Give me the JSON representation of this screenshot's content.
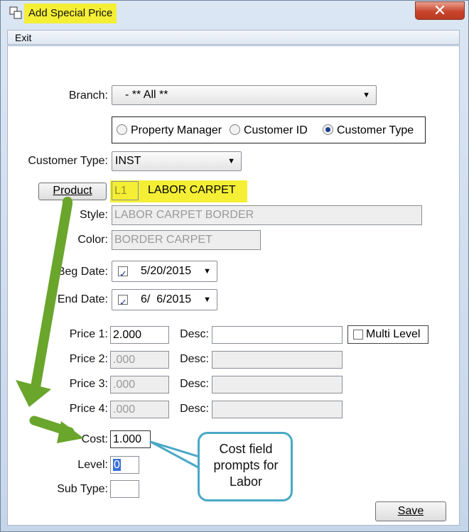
{
  "window": {
    "title": "Add Special Price",
    "close_glyph": "✕"
  },
  "menu": {
    "exit": "Exit"
  },
  "form": {
    "branch_label": "Branch:",
    "branch_value": "- ** All **",
    "radios": {
      "property_manager": "Property Manager",
      "customer_id": "Customer ID",
      "customer_type": "Customer Type",
      "selected": "customer_type"
    },
    "customer_type_label": "Customer Type:",
    "customer_type_value": "INST",
    "product_button": "Product",
    "product_code": "L1",
    "product_name": "LABOR CARPET",
    "style_label": "Style:",
    "style_value": "LABOR CARPET BORDER",
    "color_label": "Color:",
    "color_value": "BORDER CARPET",
    "beg_date_label": "Beg Date:",
    "beg_date_value": "5/20/2015",
    "end_date_label": "End Date:",
    "end_date_value": "6/  6/2015",
    "prices": [
      {
        "label": "Price 1:",
        "value": "2.000",
        "desc_label": "Desc:",
        "desc_value": ""
      },
      {
        "label": "Price 2:",
        "value": ".000",
        "desc_label": "Desc:",
        "desc_value": ""
      },
      {
        "label": "Price 3:",
        "value": ".000",
        "desc_label": "Desc:",
        "desc_value": ""
      },
      {
        "label": "Price 4:",
        "value": ".000",
        "desc_label": "Desc:",
        "desc_value": ""
      }
    ],
    "multi_level_label": "Multi Level",
    "cost_label": "Cost:",
    "cost_value": "1.000",
    "level_label": "Level:",
    "level_value": "0",
    "sub_type_label": "Sub Type:",
    "sub_type_value": "",
    "save_button": "Save"
  },
  "annotation": {
    "line1": "Cost field",
    "line2": "prompts for",
    "line3": "Labor"
  },
  "colors": {
    "highlight": "#f4ef35",
    "arrow": "#6aa52c",
    "callout_border": "#4aa8c6"
  },
  "icons": {
    "dropdown": "▼",
    "checkbox_check": "✓"
  }
}
